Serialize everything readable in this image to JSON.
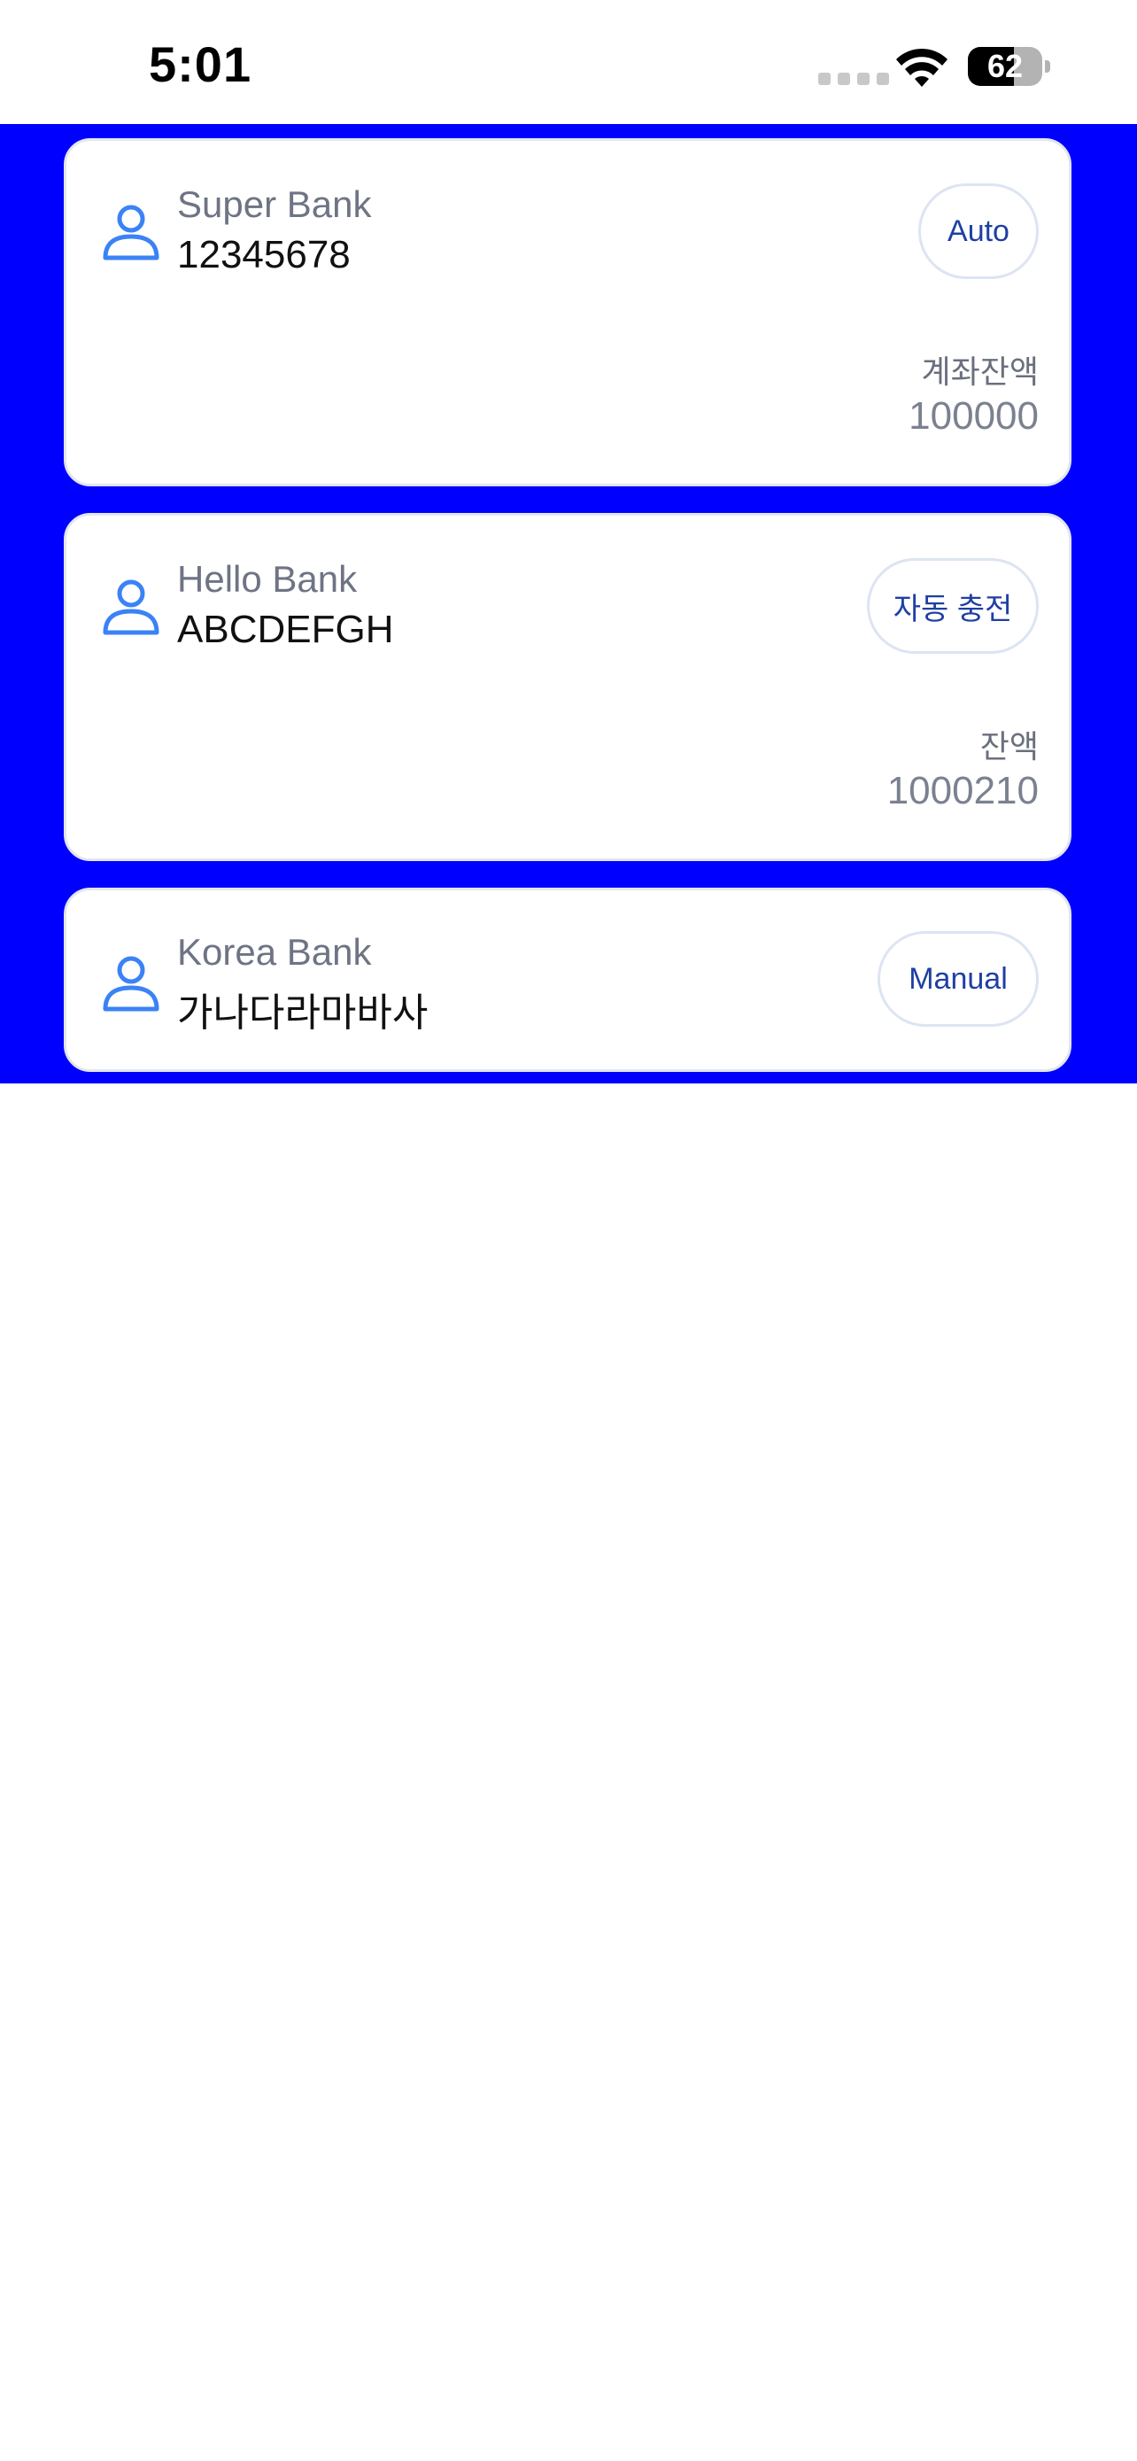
{
  "status_bar": {
    "time": "5:01",
    "battery_level": "62",
    "battery_fraction": 0.62
  },
  "colors": {
    "list_background": "#0000ff",
    "card_background": "#ffffff",
    "accent_icon": "#3b82f6",
    "button_text": "#1f3fa3"
  },
  "accounts": [
    {
      "bank_name": "Super Bank",
      "account_number": "12345678",
      "mode_label": "Auto",
      "balance_label": "계좌잔액",
      "balance_value": "100000",
      "icon": "user-icon"
    },
    {
      "bank_name": "Hello Bank",
      "account_number": "ABCDEFGH",
      "mode_label": "자동 충전",
      "balance_label": "잔액",
      "balance_value": "1000210",
      "icon": "user-icon"
    },
    {
      "bank_name": "Korea Bank",
      "account_number": "가나다라마바사",
      "mode_label": "Manual",
      "icon": "user-icon"
    }
  ]
}
